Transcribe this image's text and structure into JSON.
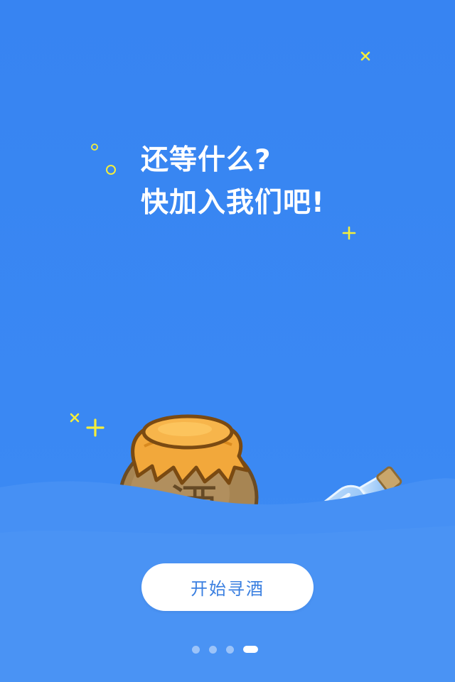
{
  "headline": {
    "line1": "还等什么?",
    "line2": "快加入我们吧!"
  },
  "illustration": {
    "jar_label": "酒",
    "jar_icon": "wine-jar-icon",
    "bottle_icon": "message-bottle-icon"
  },
  "cta": {
    "label": "开始寻酒"
  },
  "pager": {
    "total": 4,
    "current": 4
  },
  "colors": {
    "background": "#3A87F2",
    "wave_back": "#4690F4",
    "wave_front": "#5A9DF5",
    "sparkle": "#F4EE3B",
    "button_bg": "#FFFFFF",
    "button_text": "#3A7FE0"
  }
}
